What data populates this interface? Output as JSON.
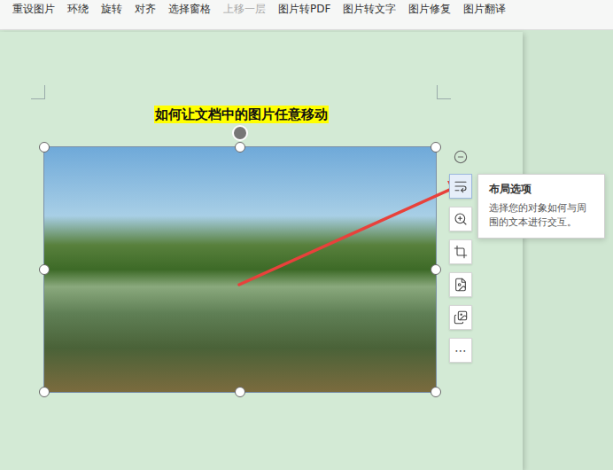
{
  "toolbar": {
    "items": [
      {
        "label": "重设图片",
        "disabled": false
      },
      {
        "label": "环绕",
        "disabled": false
      },
      {
        "label": "旋转",
        "disabled": false
      },
      {
        "label": "对齐",
        "disabled": false
      },
      {
        "label": "选择窗格",
        "disabled": false
      },
      {
        "label": "上移一层",
        "disabled": true
      },
      {
        "label": "图片转PDF",
        "disabled": false
      },
      {
        "label": "图片转文字",
        "disabled": false
      },
      {
        "label": "图片修复",
        "disabled": false
      },
      {
        "label": "图片翻译",
        "disabled": false
      }
    ]
  },
  "document": {
    "title": "如何让文档中的图片任意移动"
  },
  "image": {
    "selected": true
  },
  "float_toolbar": {
    "buttons": [
      {
        "kind": "collapse",
        "selected": false
      },
      {
        "kind": "layout",
        "selected": true
      },
      {
        "kind": "zoom",
        "selected": false
      },
      {
        "kind": "crop",
        "selected": false
      },
      {
        "kind": "convert",
        "selected": false
      },
      {
        "kind": "replace",
        "selected": false
      },
      {
        "kind": "more",
        "selected": false,
        "label": "⋯"
      }
    ]
  },
  "tooltip": {
    "title": "布局选项",
    "text": "选择您的对象如何与周围的文本进行交互。"
  }
}
